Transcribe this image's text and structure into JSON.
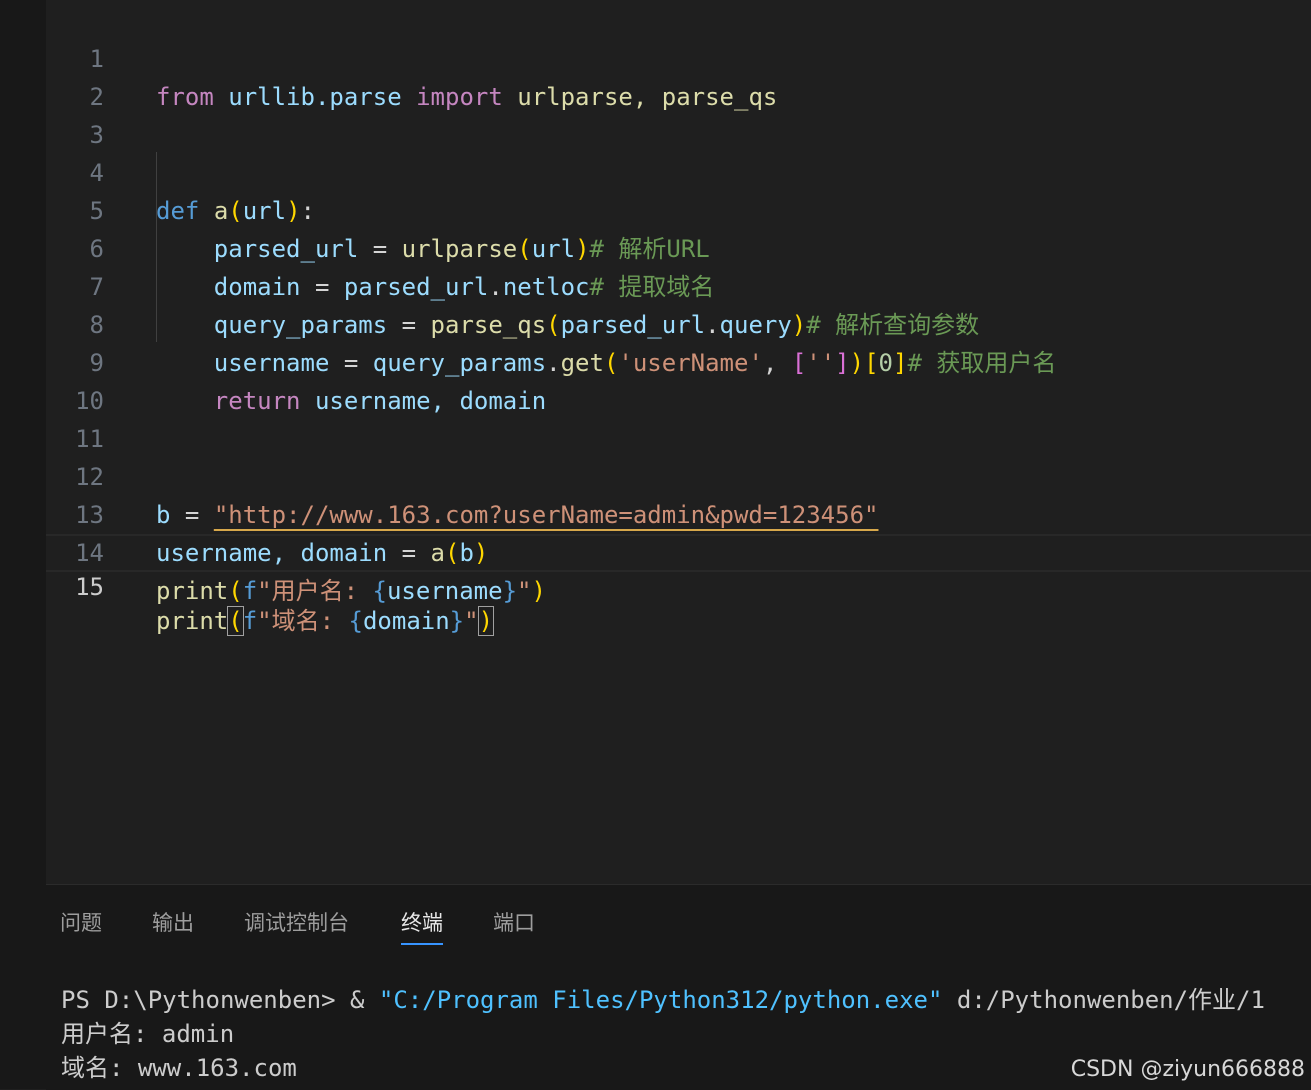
{
  "editor": {
    "lines": [
      {
        "no": "1"
      },
      {
        "no": "2"
      },
      {
        "no": "3"
      },
      {
        "no": "4"
      },
      {
        "no": "5"
      },
      {
        "no": "6"
      },
      {
        "no": "7"
      },
      {
        "no": "8"
      },
      {
        "no": "9"
      },
      {
        "no": "10"
      },
      {
        "no": "11"
      },
      {
        "no": "12"
      },
      {
        "no": "13"
      },
      {
        "no": "14"
      },
      {
        "no": "15"
      }
    ],
    "code": {
      "l1": {
        "kw_from": "from",
        "module": "urllib.parse",
        "kw_import": "import",
        "names": "urlparse, parse_qs"
      },
      "l4": {
        "kw_def": "def",
        "fn": "a",
        "param": "url"
      },
      "l5": {
        "var": "parsed_url",
        "fn": "urlparse",
        "arg": "url",
        "comment": "# 解析URL"
      },
      "l6": {
        "var": "domain",
        "obj": "parsed_url",
        "attr": "netloc",
        "comment": "# 提取域名"
      },
      "l7": {
        "var": "query_params",
        "fn": "parse_qs",
        "obj": "parsed_url",
        "attr": "query",
        "comment": "# 解析查询参数"
      },
      "l8": {
        "var": "username",
        "obj": "query_params",
        "fn": "get",
        "key": "'userName'",
        "default": "''",
        "index": "0",
        "comment": "# 获取用户名"
      },
      "l9": {
        "kw_return": "return",
        "values": "username, domain"
      },
      "l12": {
        "var": "b",
        "string": "\"http://www.163.com?userName=admin&pwd=123456\""
      },
      "l13": {
        "vars": "username, domain",
        "fn": "a",
        "arg": "b"
      },
      "l14": {
        "fn": "print",
        "prefix": "f",
        "text": "\"用户名: ",
        "expr": "username",
        "end": "\""
      },
      "l15": {
        "fn": "print",
        "prefix": "f",
        "text": "\"域名: ",
        "expr": "domain",
        "end": "\""
      }
    },
    "current_line": "15"
  },
  "panel": {
    "tabs": [
      {
        "label": "问题"
      },
      {
        "label": "输出"
      },
      {
        "label": "调试控制台"
      },
      {
        "label": "终端",
        "active": true
      },
      {
        "label": "端口"
      }
    ],
    "terminal": {
      "prompt": "PS D:\\Pythonwenben> & ",
      "exe": "\"C:/Program Files/Python312/python.exe\"",
      "script": " d:/Pythonwenben/作业/1",
      "out1": "用户名: admin",
      "out2": "域名: www.163.com"
    }
  },
  "watermark": "CSDN @ziyun666888"
}
